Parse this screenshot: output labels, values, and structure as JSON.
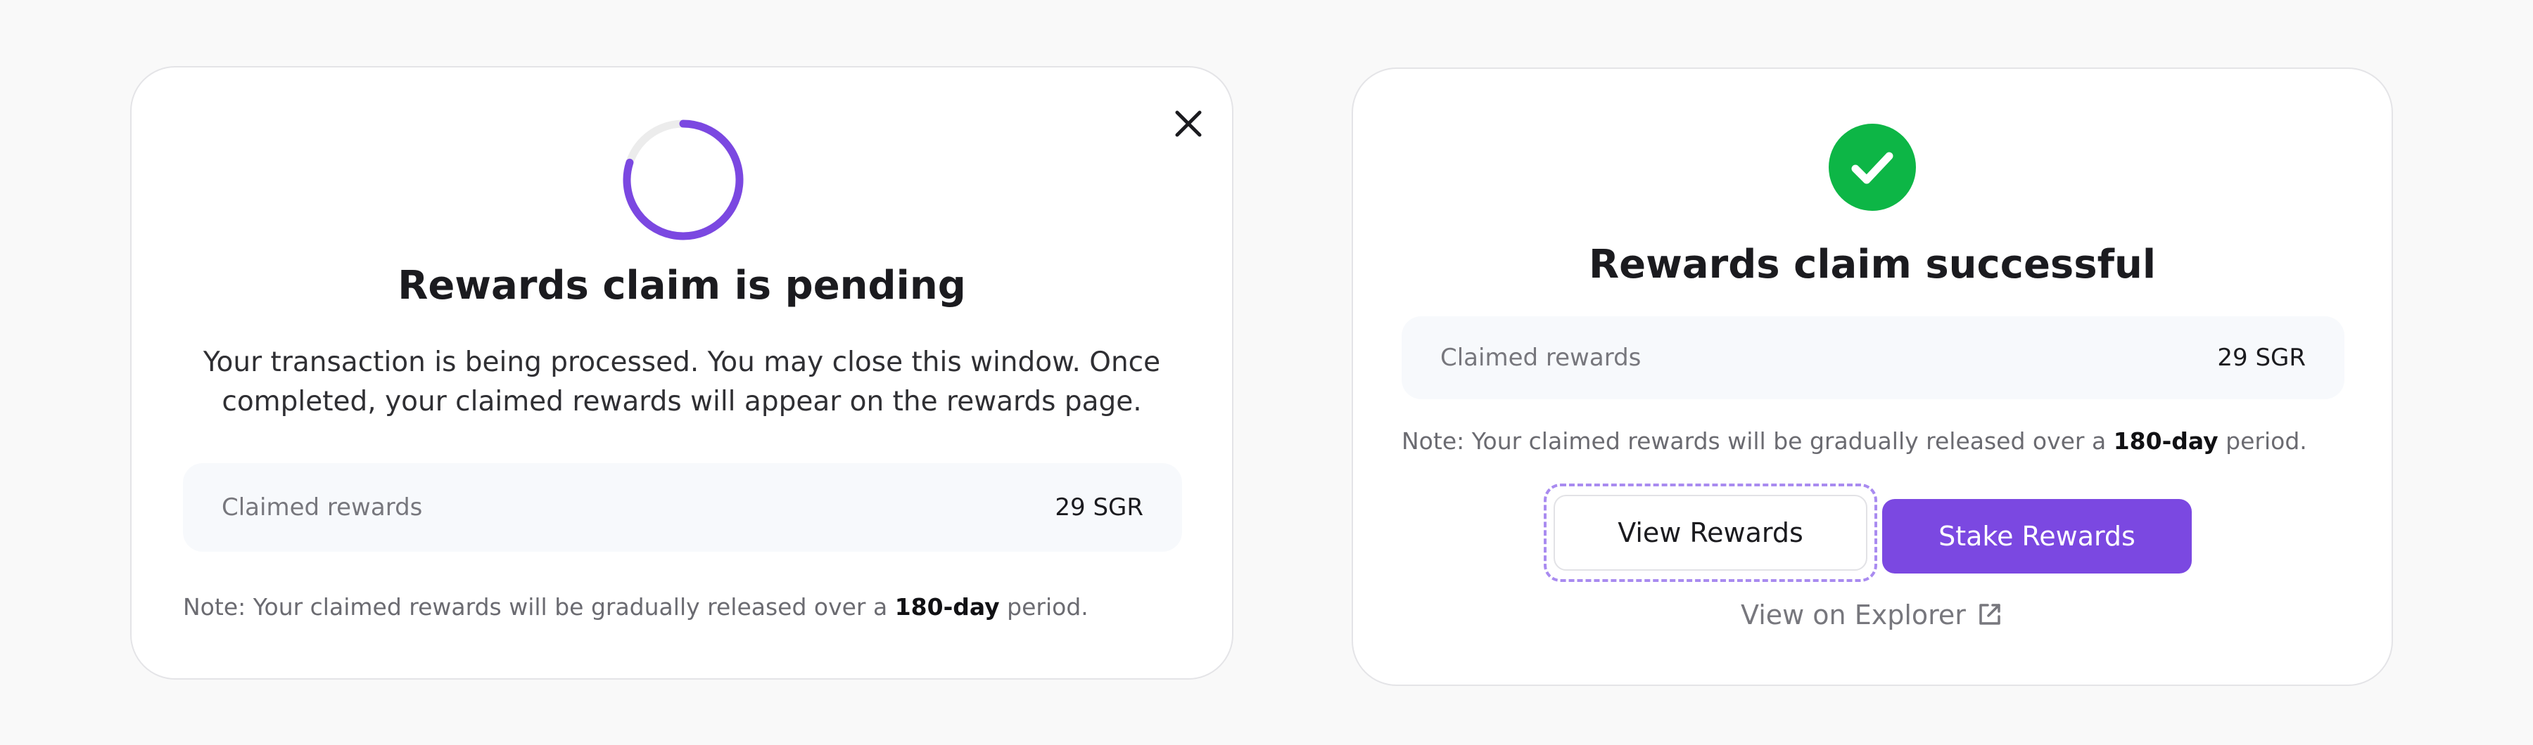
{
  "pending_modal": {
    "title": "Rewards claim is pending",
    "description_line1": "Your transaction is being processed. You may close this window. Once",
    "description_line2": "completed, your claimed rewards will appear on the rewards page.",
    "claimed_label": "Claimed rewards",
    "claimed_value": "29 SGR",
    "note_prefix": "Note: Your claimed rewards will be gradually released over a ",
    "note_bold": "180-day",
    "note_suffix": " period.",
    "icons": {
      "close": "close-icon",
      "spinner": "loading-spinner-icon"
    },
    "spinner_colors": {
      "track": "#ececec",
      "arc": "#7b48e1"
    }
  },
  "success_modal": {
    "title": "Rewards claim successful",
    "claimed_label": "Claimed rewards",
    "claimed_value": "29 SGR",
    "note_prefix": "Note: Your claimed rewards will be gradually released over a ",
    "note_bold": "180-day",
    "note_suffix": " period.",
    "view_rewards_label": "View Rewards",
    "stake_rewards_label": "Stake Rewards",
    "explorer_label": "View on Explorer",
    "icons": {
      "success": "check-circle-icon",
      "external_link": "external-link-icon"
    },
    "colors": {
      "success_green": "#0db646",
      "primary": "#7b48e1",
      "focus_ring": "#a98bf0"
    }
  }
}
